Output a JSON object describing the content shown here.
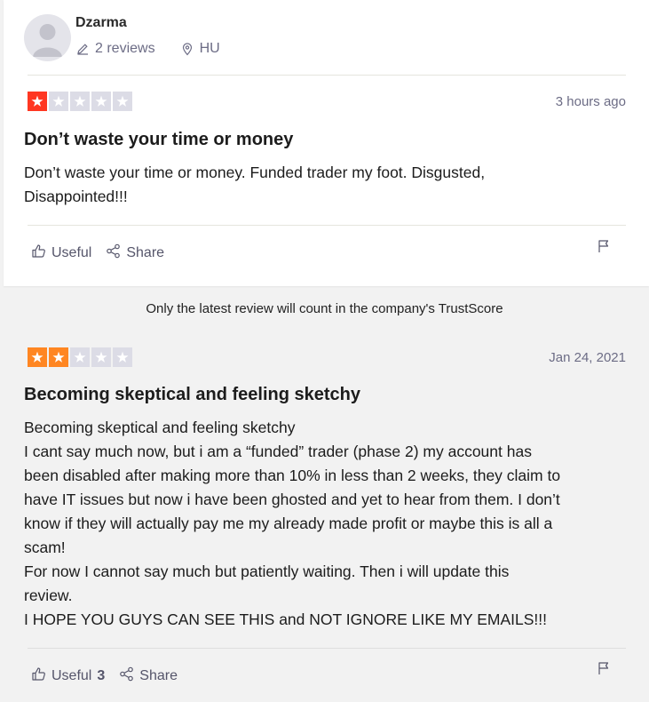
{
  "reviewer": {
    "name": "Dzarma",
    "reviews_count": "2 reviews",
    "country": "HU"
  },
  "review1": {
    "rating": 1,
    "star_color": "#ff3722",
    "date": "3 hours ago",
    "title": "Don’t waste your time or money",
    "body": [
      "Don’t waste your time or money. Funded trader my foot. Disgusted,",
      "Disappointed!!!"
    ],
    "useful_label": "Useful",
    "share_label": "Share"
  },
  "notice": "Only the latest review will count in the company's TrustScore",
  "review2": {
    "rating": 2,
    "star_color": "#ff8622",
    "date": "Jan 24, 2021",
    "title": "Becoming skeptical and feeling sketchy",
    "body": [
      "Becoming skeptical and feeling sketchy",
      "I cant say much now, but i am a “funded” trader (phase 2) my account has",
      "been disabled after making more than 10% in less than 2 weeks, they claim to",
      "have IT issues but now i have been ghosted and yet to hear from them. I don’t",
      "know if they will actually pay me my already made profit or maybe this is all a",
      "scam!",
      "For now I cannot say much but patiently waiting. Then i will update this",
      "review.",
      "I HOPE YOU GUYS CAN SEE THIS and NOT IGNORE LIKE MY EMAILS!!!"
    ],
    "useful_label": "Useful",
    "useful_count": "3",
    "share_label": "Share"
  },
  "icons": {
    "avatar": "avatar-placeholder-icon",
    "pencil": "pencil-icon",
    "location": "location-pin-icon",
    "thumb": "thumbs-up-icon",
    "share": "share-icon",
    "flag": "flag-icon",
    "star": "star-icon"
  }
}
